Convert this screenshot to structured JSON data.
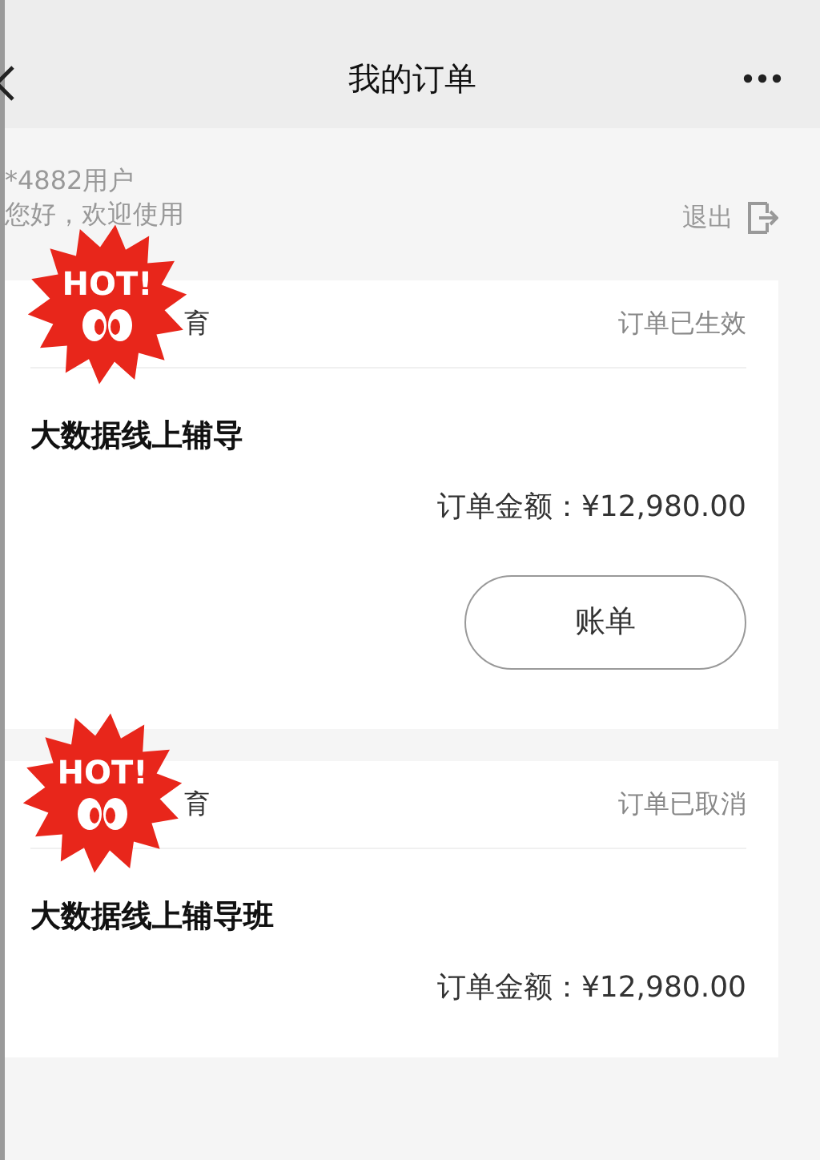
{
  "header": {
    "title": "我的订单"
  },
  "user": {
    "name": "*4882用户",
    "greeting": "您好，欢迎使用",
    "logout": "退出"
  },
  "orders": [
    {
      "sticker": "HOT!",
      "shop": "育",
      "status": "订单已生效",
      "product": "大数据线上辅导",
      "amount": "订单金额：¥12,980.00",
      "button": "账单"
    },
    {
      "sticker": "HOT!",
      "shop": "育",
      "status": "订单已取消",
      "product": "大数据线上辅导班",
      "amount": "订单金额：¥12,980.00"
    }
  ]
}
